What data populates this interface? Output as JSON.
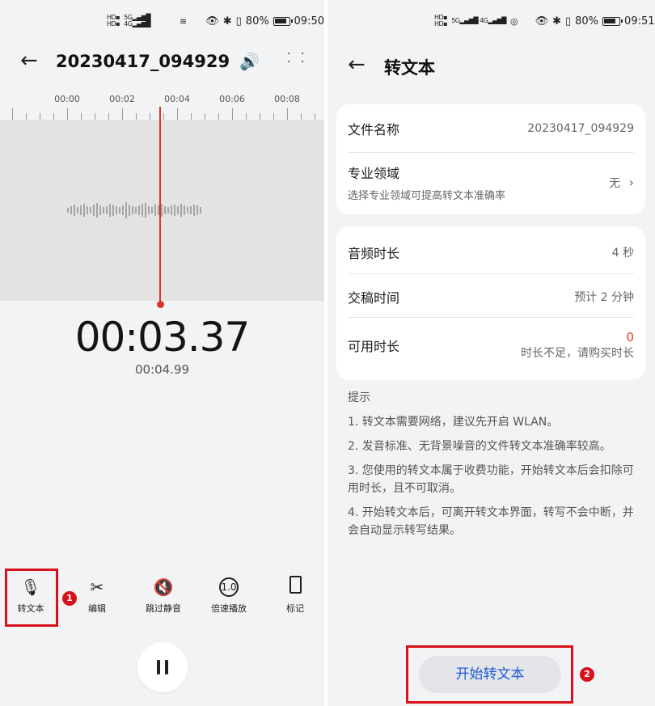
{
  "left": {
    "status": {
      "network": "5G 4G",
      "battery": "80%",
      "time": "09:50"
    },
    "header": {
      "title": "20230417_094929"
    },
    "ruler": {
      "labels": [
        "00:00",
        "00:02",
        "00:04",
        "00:06",
        "00:08"
      ]
    },
    "timer": {
      "current": "00:03.37",
      "total": "00:04.99"
    },
    "tools": [
      {
        "label": "转文本",
        "icon": "speech-to-text-icon"
      },
      {
        "label": "编辑",
        "icon": "scissors-icon"
      },
      {
        "label": "跳过静音",
        "icon": "mute-skip-icon"
      },
      {
        "label": "倍速播放",
        "icon": "speed-icon"
      },
      {
        "label": "标记",
        "icon": "bookmark-icon"
      }
    ],
    "speed_icon_text": "1.0",
    "badge": "1"
  },
  "right": {
    "status": {
      "network": "5G 4G",
      "battery": "80%",
      "time": "09:51"
    },
    "header": {
      "title": "转文本"
    },
    "file": {
      "name_label": "文件名称",
      "name_value": "20230417_094929",
      "domain_label": "专业领域",
      "domain_hint": "选择专业领域可提高转文本准确率",
      "domain_value": "无"
    },
    "info": {
      "duration_label": "音频时长",
      "duration_value": "4 秒",
      "delivery_label": "交稿时间",
      "delivery_value": "预计 2 分钟",
      "available_label": "可用时长",
      "available_value": "0",
      "available_note": "时长不足，请购买时长"
    },
    "tips": {
      "title": "提示",
      "items": [
        "1. 转文本需要网络，建议先开启 WLAN。",
        "2. 发音标准、无背景噪音的文件转文本准确率较高。",
        "3. 您使用的转文本属于收费功能，开始转文本后会扣除可用时长，且不可取消。",
        "4. 开始转文本后，可离开转文本界面，转写不会中断，并会自动显示转写结果。"
      ]
    },
    "start_button": "开始转文本",
    "badge": "2"
  }
}
